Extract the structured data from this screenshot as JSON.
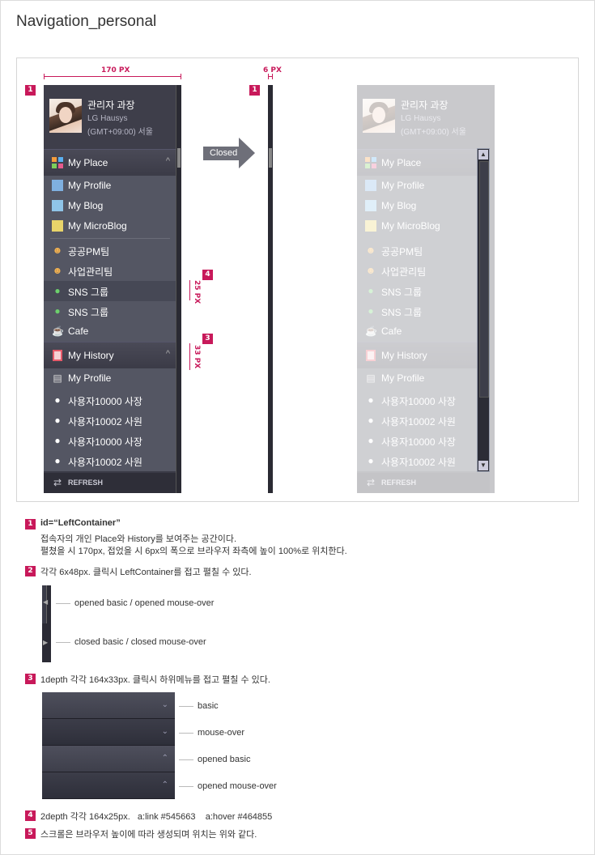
{
  "title": "Navigation_personal",
  "measures": {
    "width_open": "170 PX",
    "width_closed": "6 PX",
    "row_height": "25 PX",
    "header_height": "33 PX"
  },
  "badges": [
    "1",
    "2",
    "3",
    "4",
    "5"
  ],
  "arrow_label": "Closed",
  "profile": {
    "name": "관리자 과장",
    "company": "LG Hausys",
    "timezone": "(GMT+09:00) 서울"
  },
  "sections": [
    {
      "label": "My Place",
      "icon": "grid-icon",
      "chevron": "^",
      "items": [
        {
          "label": "My Profile",
          "icon": "profile-card-icon"
        },
        {
          "label": "My Blog",
          "icon": "blog-icon"
        },
        {
          "label": "My MicroBlog",
          "icon": "pencil-note-icon"
        }
      ],
      "items2": [
        {
          "label": "공공PM팀",
          "icon": "team-icon"
        },
        {
          "label": "사업관리팀",
          "icon": "team-icon"
        },
        {
          "label": "SNS 그룹",
          "icon": "globe-icon"
        },
        {
          "label": "SNS 그룹",
          "icon": "globe-icon"
        },
        {
          "label": "Cafe",
          "icon": "cup-icon"
        }
      ]
    },
    {
      "label": "My History",
      "icon": "book-icon",
      "chevron": "^",
      "items": [
        {
          "label": "My Profile",
          "icon": "document-icon"
        },
        {
          "label": "사용자10000 사장",
          "icon": "person-icon"
        },
        {
          "label": "사용자10002 사원",
          "icon": "person-icon"
        },
        {
          "label": "사용자10000 사장",
          "icon": "person-icon"
        },
        {
          "label": "사용자10002 사원",
          "icon": "person-icon"
        }
      ]
    }
  ],
  "refresh_label": "REFRESH",
  "notes": {
    "n1_title": "id=“LeftContainer”",
    "n1_line1": "접속자의 개인 Place와 History를 보여주는 공간이다.",
    "n1_line2": "펼쳤을 시 170px, 접었을 시 6px의 폭으로 브라우저 좌측에 높이 100%로 위치한다.",
    "n2": "각각 6x48px. 클릭시 LeftContainer를 접고 펼칠 수 있다.",
    "n2_opened": "opened basic / opened mouse-over",
    "n2_closed": "closed basic / closed mouse-over",
    "n3": "1depth 각각 164x33px. 클릭시 하위메뉴를 접고 펼칠 수 있다.",
    "n3_states": [
      "basic",
      "mouse-over",
      "opened basic",
      "opened mouse-over"
    ],
    "n4": "2depth 각각 164x25px.   a:link #545663    a:hover #464855",
    "n5": "스크롤은 브라우저 높이에 따라 생성되며 위치는 위와 같다."
  },
  "colors": {
    "accent": "#c8195a",
    "panel_bg": "#3b3b47",
    "link": "#545663",
    "hover": "#464855"
  }
}
